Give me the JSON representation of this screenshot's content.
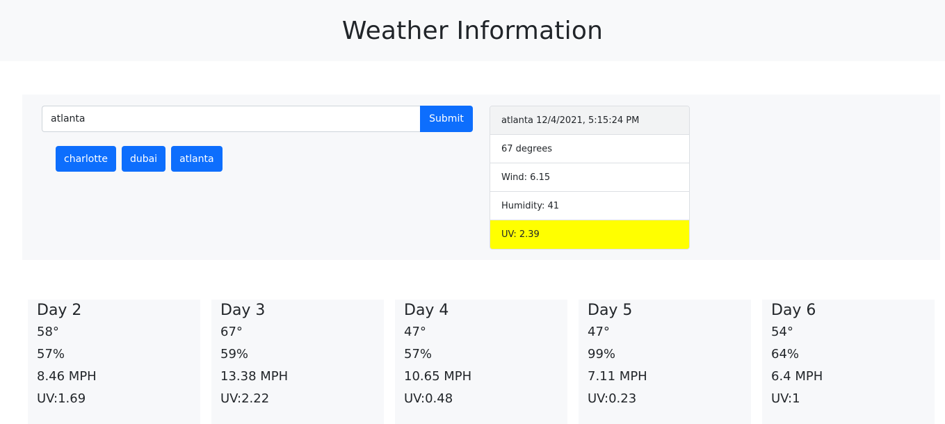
{
  "header": {
    "title": "Weather Information"
  },
  "search": {
    "value": "atlanta",
    "submit_label": "Submit"
  },
  "history": [
    "charlotte",
    "dubai",
    "atlanta"
  ],
  "current": {
    "heading": "atlanta 12/4/2021, 5:15:24 PM",
    "temp": "67 degrees",
    "wind": "Wind: 6.15",
    "humidity": "Humidity: 41",
    "uv": "UV: 2.39",
    "uv_color": "#ffff00"
  },
  "forecast": [
    {
      "title": "Day 2",
      "temp": "58°",
      "humidity": "57%",
      "wind": "8.46 MPH",
      "uv": "UV:1.69"
    },
    {
      "title": "Day 3",
      "temp": "67°",
      "humidity": "59%",
      "wind": "13.38 MPH",
      "uv": "UV:2.22"
    },
    {
      "title": "Day 4",
      "temp": "47°",
      "humidity": "57%",
      "wind": "10.65 MPH",
      "uv": "UV:0.48"
    },
    {
      "title": "Day 5",
      "temp": "47°",
      "humidity": "99%",
      "wind": "7.11 MPH",
      "uv": "UV:0.23"
    },
    {
      "title": "Day 6",
      "temp": "54°",
      "humidity": "64%",
      "wind": "6.4 MPH",
      "uv": "UV:1"
    }
  ],
  "colors": {
    "primary": "#0d6efd",
    "panel": "#f7f8fa",
    "header_bg": "#f8f9fa"
  }
}
